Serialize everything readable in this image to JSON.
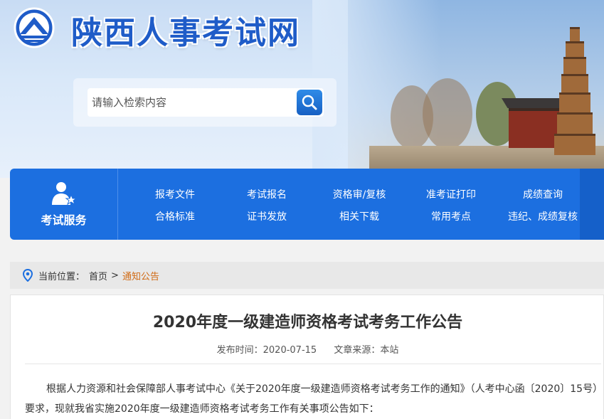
{
  "header": {
    "site_title": "陕西人事考试网",
    "search_placeholder": "请输入检索内容"
  },
  "nav": {
    "service_label": "考试服务",
    "links_row1": [
      "报考文件",
      "考试报名",
      "资格审/复核",
      "准考证打印",
      "成绩查询"
    ],
    "links_row2": [
      "合格标准",
      "证书发放",
      "相关下载",
      "常用考点",
      "违纪、成绩复核"
    ]
  },
  "breadcrumb": {
    "prefix": "当前位置：",
    "home": "首页",
    "separator": ">",
    "current": "通知公告"
  },
  "article": {
    "title": "2020年度一级建造师资格考试考务工作公告",
    "publish_time_label": "发布时间：2020-07-15",
    "source_label": "文章来源：本站",
    "paragraph": "根据人力资源和社会保障部人事考试中心《关于2020年度一级建造师资格考试考务工作的通知》（人考中心函〔2020〕15号）要求，现就我省实施2020年度一级建造师资格考试考务工作有关事项公告如下："
  },
  "colors": {
    "brand_blue": "#1c6fe0",
    "title_blue": "#1f5cc8",
    "breadcrumb_current": "#d06a14"
  }
}
